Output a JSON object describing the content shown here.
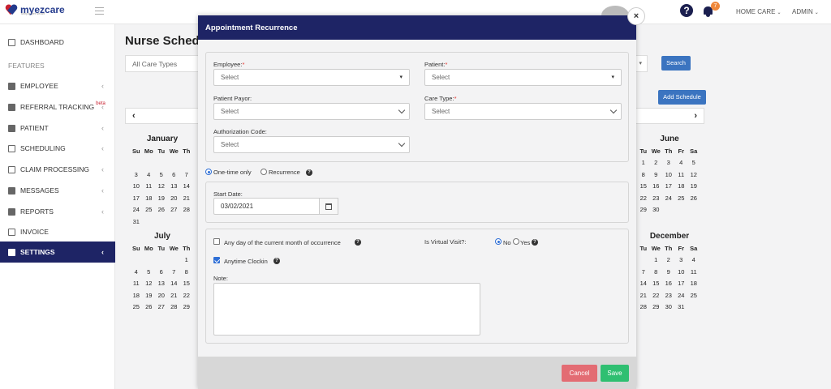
{
  "brand": {
    "name": "myezcare",
    "tagline": "simple yet smart"
  },
  "topbar": {
    "home_care": "HOME CARE",
    "admin": "ADMIN",
    "notifications": "7"
  },
  "sidebar": {
    "features_label": "FEATURES",
    "items": [
      {
        "label": "DASHBOARD",
        "icon": "home-icon"
      },
      {
        "label": "EMPLOYEE",
        "icon": "users-icon"
      },
      {
        "label": "REFERRAL TRACKING",
        "icon": "user-icon",
        "badge": "beta"
      },
      {
        "label": "PATIENT",
        "icon": "user-icon"
      },
      {
        "label": "SCHEDULING",
        "icon": "calendar-icon"
      },
      {
        "label": "CLAIM PROCESSING",
        "icon": "document-icon"
      },
      {
        "label": "MESSAGES",
        "icon": "envelope-icon"
      },
      {
        "label": "REPORTS",
        "icon": "chart-icon"
      },
      {
        "label": "INVOICE",
        "icon": "invoice-icon"
      },
      {
        "label": "SETTINGS",
        "icon": "gear-icon"
      }
    ]
  },
  "page": {
    "title": "Nurse Schedu",
    "care_types_placeholder": "All Care Types",
    "search_label": "Search",
    "add_schedule_label": "Add Schedule",
    "prev": "‹",
    "next": "›"
  },
  "calendars": {
    "day_headers": [
      "Su",
      "Mo",
      "Tu",
      "We",
      "Th"
    ],
    "day_headers_right": [
      "Tu",
      "We",
      "Th",
      "Fr",
      "Sa"
    ],
    "january": {
      "title": "January",
      "rows": [
        [
          "",
          "",
          "",
          "",
          ""
        ],
        [
          "3",
          "4",
          "5",
          "6",
          "7"
        ],
        [
          "10",
          "11",
          "12",
          "13",
          "14"
        ],
        [
          "17",
          "18",
          "19",
          "20",
          "21"
        ],
        [
          "24",
          "25",
          "26",
          "27",
          "28"
        ],
        [
          "31",
          "",
          "",
          "",
          ""
        ]
      ]
    },
    "july": {
      "title": "July",
      "rows": [
        [
          "",
          "",
          "",
          "",
          "1"
        ],
        [
          "4",
          "5",
          "6",
          "7",
          "8"
        ],
        [
          "11",
          "12",
          "13",
          "14",
          "15"
        ],
        [
          "18",
          "19",
          "20",
          "21",
          "22"
        ],
        [
          "25",
          "26",
          "27",
          "28",
          "29"
        ]
      ]
    },
    "june": {
      "title": "June",
      "rows": [
        [
          "1",
          "2",
          "3",
          "4",
          "5"
        ],
        [
          "8",
          "9",
          "10",
          "11",
          "12"
        ],
        [
          "15",
          "16",
          "17",
          "18",
          "19"
        ],
        [
          "22",
          "23",
          "24",
          "25",
          "26"
        ],
        [
          "29",
          "30",
          "",
          "",
          ""
        ]
      ]
    },
    "december": {
      "title": "December",
      "rows": [
        [
          "",
          "1",
          "2",
          "3",
          "4"
        ],
        [
          "7",
          "8",
          "9",
          "10",
          "11"
        ],
        [
          "14",
          "15",
          "16",
          "17",
          "18"
        ],
        [
          "21",
          "22",
          "23",
          "24",
          "25"
        ],
        [
          "28",
          "29",
          "30",
          "31",
          ""
        ]
      ]
    }
  },
  "modal": {
    "title": "Appointment Recurrence",
    "close": "×",
    "employee_label": "Employee:",
    "employee_value": "Select",
    "patient_label": "Patient:",
    "patient_value": "Select",
    "payor_label": "Patient Payor:",
    "payor_value": "Select",
    "care_type_label": "Care Type:",
    "care_type_value": "Select",
    "auth_label": "Authorization Code:",
    "auth_value": "Select",
    "one_time_label": "One-time only",
    "recurrence_label": "Recurrence",
    "start_date_label": "Start Date:",
    "start_date_value": "03/02/2021",
    "any_day_label": "Any day of the current month of occurrence",
    "virtual_label": "Is Virtual Visit?:",
    "no_label": "No",
    "yes_label": "Yes",
    "anytime_label": "Anytime Clockin",
    "note_label": "Note:",
    "cancel_label": "Cancel",
    "save_label": "Save",
    "required_mark": "*"
  }
}
